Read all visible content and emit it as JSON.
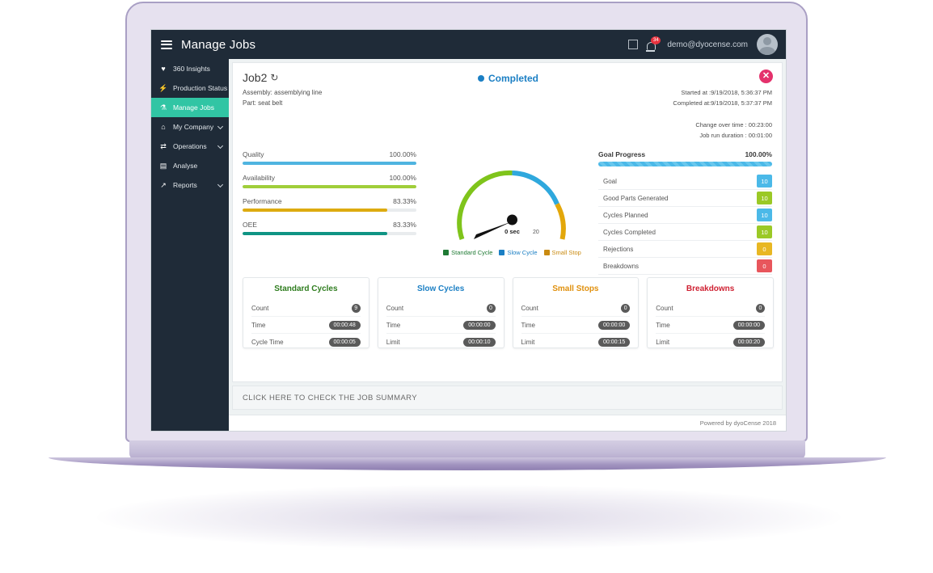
{
  "topbar": {
    "menu_icon": "hamburger-icon",
    "title": "Manage Jobs",
    "expand_icon": "fullscreen-icon",
    "bell_icon": "bell-icon",
    "bell_badge": "34",
    "user_email": "demo@dyocense.com",
    "avatar": "user-avatar"
  },
  "sidebar": {
    "items": [
      {
        "label": "360 Insights",
        "icon": "heart-icon",
        "active": false,
        "caret": false
      },
      {
        "label": "Production Status",
        "icon": "bolt-icon",
        "active": false,
        "caret": false
      },
      {
        "label": "Manage Jobs",
        "icon": "flask-icon",
        "active": true,
        "caret": false
      },
      {
        "label": "My Company",
        "icon": "home-icon",
        "active": false,
        "caret": true
      },
      {
        "label": "Operations",
        "icon": "shuffle-icon",
        "active": false,
        "caret": true
      },
      {
        "label": "Analyse",
        "icon": "book-icon",
        "active": false,
        "caret": false
      },
      {
        "label": "Reports",
        "icon": "trend-icon",
        "active": false,
        "caret": true
      }
    ]
  },
  "job": {
    "title": "Job2",
    "refresh_icon": "refresh-icon",
    "status": "Completed",
    "status_color": "#1b7fc4",
    "close_icon": "close-icon",
    "assembly": "Assembly: assemblying line",
    "part": "Part: seat belt",
    "started_at": "Started at :9/19/2018, 5:36:37 PM",
    "completed_at": "Completed at:9/19/2018, 5:37:37 PM",
    "change_over_time": "Change over time : 00:23:00",
    "run_duration": "Job run duration : 00:01:00"
  },
  "metrics": [
    {
      "label": "Quality",
      "value": "100.00%",
      "pct": 100,
      "color": "#4fb4e0"
    },
    {
      "label": "Availability",
      "value": "100.00%",
      "pct": 100,
      "color": "#a0ce3a"
    },
    {
      "label": "Performance",
      "value": "83.33%",
      "pct": 83.33,
      "color": "#ddab10"
    },
    {
      "label": "OEE",
      "value": "83.33%",
      "pct": 83.33,
      "color": "#0f9484"
    }
  ],
  "gauge": {
    "center_label": "0 sec",
    "max_label": "20",
    "segments": [
      {
        "name": "Standard Cycle",
        "color": "#7fc41b"
      },
      {
        "name": "Slow Cycle",
        "color": "#2fa8dd"
      },
      {
        "name": "Small Stop",
        "color": "#e3a70a"
      }
    ],
    "legend": [
      {
        "label": "Standard Cycle",
        "color": "#1f7a34"
      },
      {
        "label": "Slow Cycle",
        "color": "#1b7fc4"
      },
      {
        "label": "Small Stop",
        "color": "#c98a10"
      }
    ]
  },
  "goal_progress": {
    "title": "Goal Progress",
    "value": "100.00%",
    "pct": 100,
    "rows": [
      {
        "label": "Goal",
        "value": "10",
        "color": "#4bb9e8"
      },
      {
        "label": "Good Parts Generated",
        "value": "10",
        "color": "#9bc926"
      },
      {
        "label": "Cycles Planned",
        "value": "10",
        "color": "#4bb9e8"
      },
      {
        "label": "Cycles Completed",
        "value": "10",
        "color": "#9bc926"
      },
      {
        "label": "Rejections",
        "value": "0",
        "color": "#e8b723"
      },
      {
        "label": "Breakdowns",
        "value": "0",
        "color": "#e8565c"
      }
    ]
  },
  "stat_cards": [
    {
      "title": "Standard Cycles",
      "color": "#2f7d1f",
      "rows": [
        {
          "label": "Count",
          "value": "9",
          "round": true
        },
        {
          "label": "Time",
          "value": "00:00:48",
          "round": false
        },
        {
          "label": "Cycle Time",
          "value": "00:00:05",
          "round": false
        }
      ]
    },
    {
      "title": "Slow Cycles",
      "color": "#1b7fc4",
      "rows": [
        {
          "label": "Count",
          "value": "0",
          "round": true
        },
        {
          "label": "Time",
          "value": "00:00:00",
          "round": false
        },
        {
          "label": "Limit",
          "value": "00:00:10",
          "round": false
        }
      ]
    },
    {
      "title": "Small Stops",
      "color": "#e0900d",
      "rows": [
        {
          "label": "Count",
          "value": "0",
          "round": true
        },
        {
          "label": "Time",
          "value": "00:00:00",
          "round": false
        },
        {
          "label": "Limit",
          "value": "00:00:15",
          "round": false
        }
      ]
    },
    {
      "title": "Breakdowns",
      "color": "#cf2233",
      "rows": [
        {
          "label": "Count",
          "value": "0",
          "round": true
        },
        {
          "label": "Time",
          "value": "00:00:00",
          "round": false
        },
        {
          "label": "Limit",
          "value": "00:00:20",
          "round": false
        }
      ]
    }
  ],
  "summary_bar": {
    "label": "CLICK HERE TO CHECK THE JOB SUMMARY"
  },
  "footer": {
    "text": "Powered by dyoCense 2018"
  }
}
